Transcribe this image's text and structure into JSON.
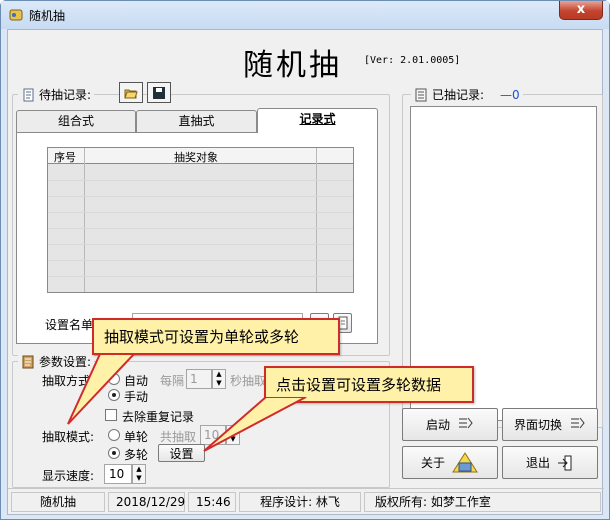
{
  "window": {
    "title": "随机抽",
    "close": "x"
  },
  "header": {
    "title": "随机抽",
    "version": "[Ver: 2.01.0005]"
  },
  "pending": {
    "label": "待抽记录:"
  },
  "drawn": {
    "label": "已抽记录:",
    "count": "—0"
  },
  "tabs": [
    {
      "label": "组合式"
    },
    {
      "label": "直抽式"
    },
    {
      "label": "记录式"
    }
  ],
  "grid": {
    "headers": [
      "序号",
      "抽奖对象"
    ]
  },
  "file": {
    "label": "设置名单文件:"
  },
  "settings": {
    "label": "参数设置:",
    "method_label": "抽取方式:",
    "auto_label": "自动",
    "every_label": "每隔",
    "every_value": "1",
    "seconds_label": "秒抽取",
    "manual_label": "手动",
    "dedupe_label": "去除重复记录",
    "mode_label": "抽取模式:",
    "single_label": "单轮",
    "total_label": "共抽取",
    "total_value": "10",
    "multi_label": "多轮",
    "setup_button": "设置",
    "speed_label": "显示速度:",
    "speed_value": "10"
  },
  "buttons": {
    "start": "启动",
    "switch": "界面切换",
    "about": "关于",
    "exit": "退出"
  },
  "callouts": {
    "mode": "抽取模式可设置为单轮或多轮",
    "setup": "点击设置可设置多轮数据"
  },
  "status": {
    "app": "随机抽",
    "date": "2018/12/29",
    "time": "15:46",
    "designer": "程序设计: 林飞",
    "copyright": "版权所有: 如梦工作室"
  }
}
